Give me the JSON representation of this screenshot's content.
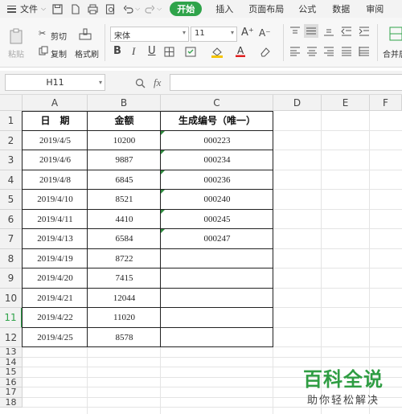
{
  "menu": {
    "file_label": "文件",
    "tabs": [
      "开始",
      "插入",
      "页面布局",
      "公式",
      "数据",
      "审阅"
    ]
  },
  "ribbon": {
    "paste": "粘贴",
    "cut": "剪切",
    "copy": "复制",
    "format_painter": "格式刷",
    "font_name": "宋体",
    "font_size": "11",
    "bold": "B",
    "italic": "I",
    "underline": "U",
    "grow_font": "A⁺",
    "shrink_font": "A⁻",
    "merge_center": "合并居",
    "accent_color": "#2fa34a"
  },
  "formula_bar": {
    "name_box": "H11",
    "fx": "fx"
  },
  "sheet": {
    "columns": [
      "A",
      "B",
      "C",
      "D",
      "E",
      "F"
    ],
    "rows": [
      "1",
      "2",
      "3",
      "4",
      "5",
      "6",
      "7",
      "8",
      "9",
      "10",
      "11",
      "12",
      "13",
      "14",
      "15",
      "16",
      "17",
      "18"
    ],
    "headers": [
      "日　期",
      "金额",
      "生成编号（唯一）"
    ],
    "data": [
      [
        "2019/4/5",
        "10200",
        "000223"
      ],
      [
        "2019/4/6",
        "9887",
        "000234"
      ],
      [
        "2019/4/8",
        "6845",
        "000236"
      ],
      [
        "2019/4/10",
        "8521",
        "000240"
      ],
      [
        "2019/4/11",
        "4410",
        "000245"
      ],
      [
        "2019/4/13",
        "6584",
        "000247"
      ],
      [
        "2019/4/19",
        "8722",
        ""
      ],
      [
        "2019/4/20",
        "7415",
        ""
      ],
      [
        "2019/4/21",
        "12044",
        ""
      ],
      [
        "2019/4/22",
        "11020",
        ""
      ],
      [
        "2019/4/25",
        "8578",
        ""
      ]
    ]
  },
  "watermark": {
    "title": "百科全说",
    "subtitle": "助你轻松解决"
  }
}
